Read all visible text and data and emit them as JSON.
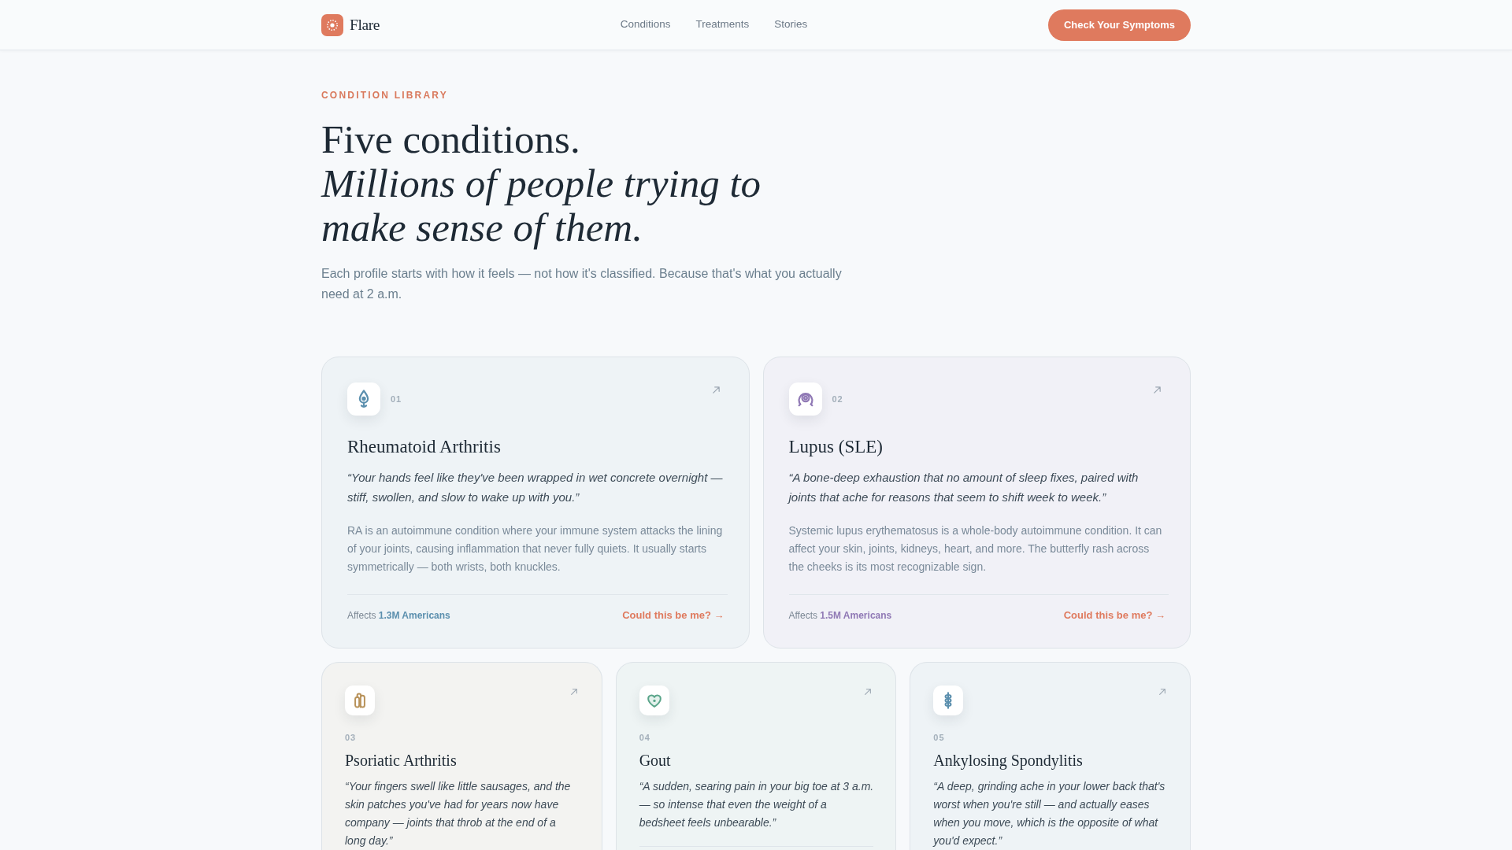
{
  "nav": {
    "brand": "Flare",
    "links": [
      {
        "label": "Conditions"
      },
      {
        "label": "Treatments"
      },
      {
        "label": "Stories"
      }
    ],
    "cta": "Check Your Symptoms"
  },
  "header": {
    "eyebrow": "CONDITION LIBRARY",
    "title": "Five conditions.",
    "title_italic": "Millions of people trying to make sense of them.",
    "intro": "Each profile starts with how it feels — not how it's classified. Because that's what you actually need at 2 a.m."
  },
  "featured_conditions": [
    {
      "number": "01",
      "name": "Rheumatoid Arthritis",
      "color": "#5b8fae",
      "quote": "“Your hands feel like they've been wrapped in wet concrete overnight — stiff, swollen, and slow to wake up with you.”",
      "description": "RA is an autoimmune condition where your immune system attacks the lining of your joints, causing inflammation that never fully quiets. It usually starts symmetrically — both wrists, both knuckles.",
      "affects": "Affects **1.3M Americans**",
      "link": "Could this be me? →"
    },
    {
      "number": "02",
      "name": "Lupus (SLE)",
      "color": "#9079b5",
      "quote": "“A bone-deep exhaustion that no amount of sleep fixes, paired with joints that ache for reasons that seem to shift week to week.”",
      "description": "Systemic lupus erythematosus is a whole-body autoimmune condition. It can affect your skin, joints, kidneys, heart, and more. The butterfly rash across the cheeks is its most recognizable sign.",
      "affects": "Affects **1.5M Americans**",
      "link": "Could this be me? →"
    }
  ],
  "more_conditions": [
    {
      "number": "03",
      "name": "Psoriatic Arthritis",
      "color": "#b8925a",
      "quote": "“Your fingers swell like little sausages, and the skin patches you've had for years now have company — joints that throb at the end of a long day.”"
    },
    {
      "number": "04",
      "name": "Gout",
      "color": "#5aa58a",
      "quote": "“A sudden, searing pain in your big toe at 3 a.m. — so intense that even the weight of a bedsheet feels unbearable.”"
    },
    {
      "number": "05",
      "name": "Ankylosing Spondylitis",
      "color": "#5b8fae",
      "quote": "“A deep, grinding ache in your lower back that's worst when you're still — and actually eases when you move, which is the opposite of what you'd expect.”"
    }
  ]
}
